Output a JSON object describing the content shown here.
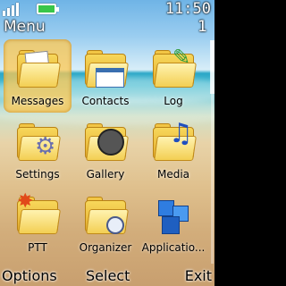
{
  "status": {
    "time": "11:50"
  },
  "header": {
    "title": "Menu",
    "page": "1"
  },
  "items": [
    {
      "label": "Messages",
      "icon": "messages-icon",
      "selected": true
    },
    {
      "label": "Contacts",
      "icon": "contacts-icon",
      "selected": false
    },
    {
      "label": "Log",
      "icon": "log-icon",
      "selected": false
    },
    {
      "label": "Settings",
      "icon": "settings-icon",
      "selected": false
    },
    {
      "label": "Gallery",
      "icon": "gallery-icon",
      "selected": false
    },
    {
      "label": "Media",
      "icon": "media-icon",
      "selected": false
    },
    {
      "label": "PTT",
      "icon": "ptt-icon",
      "selected": false
    },
    {
      "label": "Organizer",
      "icon": "organizer-icon",
      "selected": false
    },
    {
      "label": "Applicatio...",
      "icon": "applications-icon",
      "selected": false
    }
  ],
  "softkeys": {
    "left": "Options",
    "center": "Select",
    "right": "Exit"
  },
  "colors": {
    "selection": "#f7c85a",
    "folder": "#f2c645"
  }
}
